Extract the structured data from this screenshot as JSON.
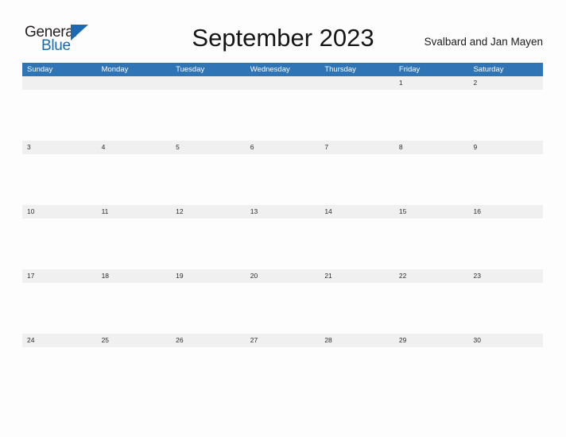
{
  "brand": {
    "name_top": "General",
    "name_bottom": "Blue",
    "accent_color": "#1b69b0"
  },
  "header": {
    "title": "September 2023",
    "region": "Svalbard and Jan Mayen"
  },
  "calendar": {
    "header_bg": "#2f75b5",
    "row_band_bg": "#f0f0f0",
    "rule_color": "#2f75b5",
    "weekdays": [
      "Sunday",
      "Monday",
      "Tuesday",
      "Wednesday",
      "Thursday",
      "Friday",
      "Saturday"
    ],
    "weeks": [
      [
        "",
        "",
        "",
        "",
        "",
        "1",
        "2"
      ],
      [
        "3",
        "4",
        "5",
        "6",
        "7",
        "8",
        "9"
      ],
      [
        "10",
        "11",
        "12",
        "13",
        "14",
        "15",
        "16"
      ],
      [
        "17",
        "18",
        "19",
        "20",
        "21",
        "22",
        "23"
      ],
      [
        "24",
        "25",
        "26",
        "27",
        "28",
        "29",
        "30"
      ]
    ]
  }
}
